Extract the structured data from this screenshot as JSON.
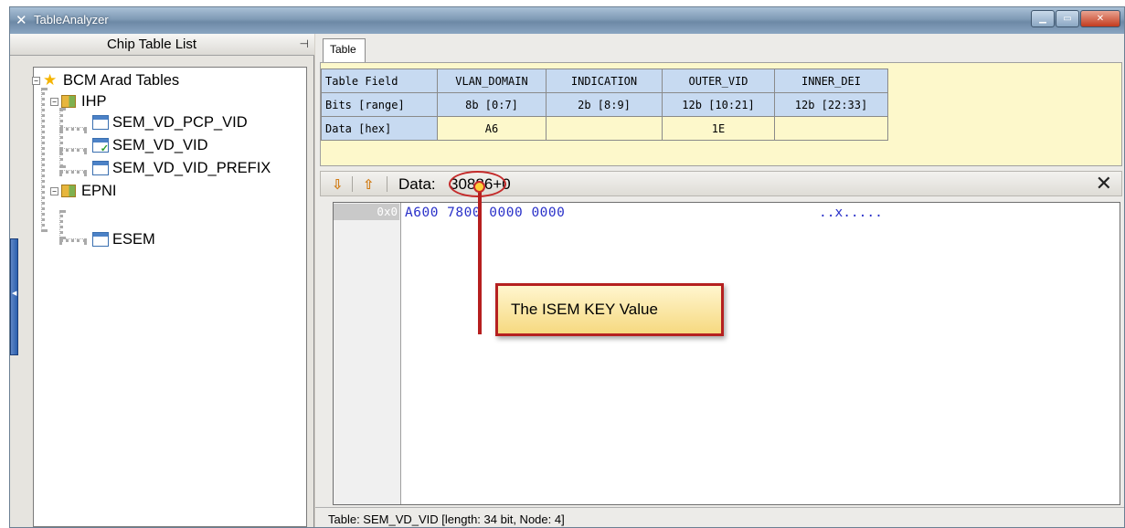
{
  "window": {
    "title": "TableAnalyzer",
    "title_icon": "x-logo-icon"
  },
  "left_panel": {
    "title": "Chip Table List",
    "tree": [
      {
        "label": "BCM Arad Tables",
        "icon": "star-icon",
        "expander": "−"
      },
      {
        "label": "IHP",
        "icon": "folder-icon",
        "expander": "−"
      },
      {
        "label": "SEM_VD_PCP_VID",
        "icon": "table-icon"
      },
      {
        "label": "SEM_VD_VID",
        "icon": "table-selected-icon"
      },
      {
        "label": "SEM_VD_VID_PREFIX",
        "icon": "table-icon"
      },
      {
        "label": "EPNI",
        "icon": "folder-icon",
        "expander": "−"
      },
      {
        "label": "ESEM",
        "icon": "table-icon"
      }
    ]
  },
  "right_panel": {
    "tab": "Table",
    "fields_table": {
      "row_headers": [
        "Table Field",
        "Bits [range]",
        "Data [hex]"
      ],
      "columns": [
        {
          "name": "VLAN_DOMAIN",
          "bits": "8b [0:7]",
          "data": "A6"
        },
        {
          "name": "INDICATION",
          "bits": "2b [8:9]",
          "data": ""
        },
        {
          "name": "OUTER_VID",
          "bits": "12b [10:21]",
          "data": "1E"
        },
        {
          "name": "INNER_DEI",
          "bits": "12b [22:33]",
          "data": ""
        }
      ]
    },
    "toolbar": {
      "data_label": "Data:",
      "data_value": "30886+0",
      "icons": [
        "sort-down-icon",
        "sort-up-icon",
        "close-x-icon"
      ]
    },
    "hex_view": {
      "offset": "0x0",
      "hex": "A600 7800 0000 0000",
      "ascii": "..x....."
    },
    "status": "Table: SEM_VD_VID [length: 34 bit,  Node: 4]"
  },
  "annotation": {
    "text": "The ISEM KEY Value"
  },
  "colors": {
    "callout_border": "#b52020",
    "hex_text": "#2a31c9",
    "field_header": "#c7daf1",
    "data_bg": "#fdf8cb"
  }
}
